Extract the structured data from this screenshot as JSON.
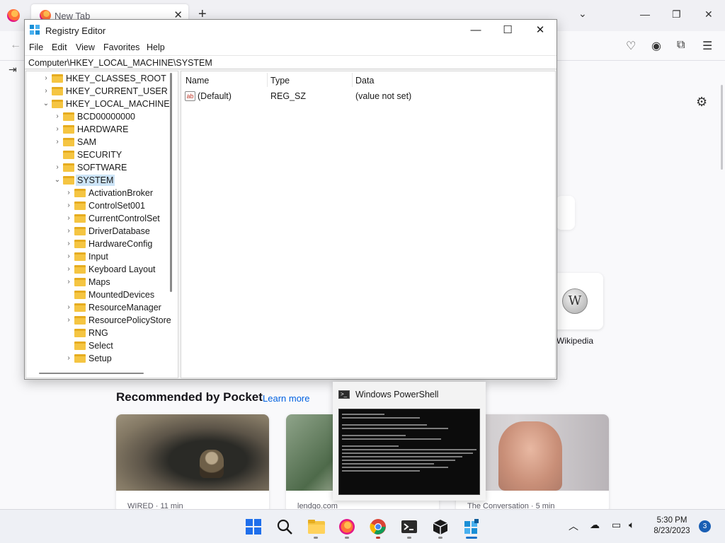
{
  "browser": {
    "tab_title": "New Tab",
    "pocket_heading": "Recommended by Pocket",
    "pocket_link": "Learn more",
    "shortcut_label": "Wikipedia",
    "cards": [
      {
        "source": "WIRED · 11 min"
      },
      {
        "source": "lendgo.com"
      },
      {
        "source": "The Conversation · 5 min"
      }
    ]
  },
  "registry": {
    "title": "Registry Editor",
    "menu": [
      "File",
      "Edit",
      "View",
      "Favorites",
      "Help"
    ],
    "address": "Computer\\HKEY_LOCAL_MACHINE\\SYSTEM",
    "tree": [
      {
        "label": "HKEY_CLASSES_ROOT",
        "depth": 0,
        "expander": "›"
      },
      {
        "label": "HKEY_CURRENT_USER",
        "depth": 0,
        "expander": "›"
      },
      {
        "label": "HKEY_LOCAL_MACHINE",
        "depth": 0,
        "expander": "⌄"
      },
      {
        "label": "BCD00000000",
        "depth": 1,
        "expander": "›"
      },
      {
        "label": "HARDWARE",
        "depth": 1,
        "expander": "›"
      },
      {
        "label": "SAM",
        "depth": 1,
        "expander": "›"
      },
      {
        "label": "SECURITY",
        "depth": 1,
        "expander": ""
      },
      {
        "label": "SOFTWARE",
        "depth": 1,
        "expander": "›"
      },
      {
        "label": "SYSTEM",
        "depth": 1,
        "expander": "⌄",
        "selected": true
      },
      {
        "label": "ActivationBroker",
        "depth": 2,
        "expander": "›"
      },
      {
        "label": "ControlSet001",
        "depth": 2,
        "expander": "›"
      },
      {
        "label": "CurrentControlSet",
        "depth": 2,
        "expander": "›"
      },
      {
        "label": "DriverDatabase",
        "depth": 2,
        "expander": "›"
      },
      {
        "label": "HardwareConfig",
        "depth": 2,
        "expander": "›"
      },
      {
        "label": "Input",
        "depth": 2,
        "expander": "›"
      },
      {
        "label": "Keyboard Layout",
        "depth": 2,
        "expander": "›"
      },
      {
        "label": "Maps",
        "depth": 2,
        "expander": "›"
      },
      {
        "label": "MountedDevices",
        "depth": 2,
        "expander": ""
      },
      {
        "label": "ResourceManager",
        "depth": 2,
        "expander": "›"
      },
      {
        "label": "ResourcePolicyStore",
        "depth": 2,
        "expander": "›"
      },
      {
        "label": "RNG",
        "depth": 2,
        "expander": ""
      },
      {
        "label": "Select",
        "depth": 2,
        "expander": ""
      },
      {
        "label": "Setup",
        "depth": 2,
        "expander": "›"
      }
    ],
    "columns": {
      "name": "Name",
      "type": "Type",
      "data": "Data"
    },
    "values": [
      {
        "name": "(Default)",
        "type": "REG_SZ",
        "data": "(value not set)",
        "icon": "ab"
      }
    ]
  },
  "powershell_preview": {
    "title": "Windows PowerShell"
  },
  "taskbar": {
    "time": "5:30 PM",
    "date": "8/23/2023",
    "notifications": "3"
  },
  "colors": {
    "accent": "#1a73c8",
    "selection": "#cce4f7",
    "folder": "#f5c542"
  }
}
